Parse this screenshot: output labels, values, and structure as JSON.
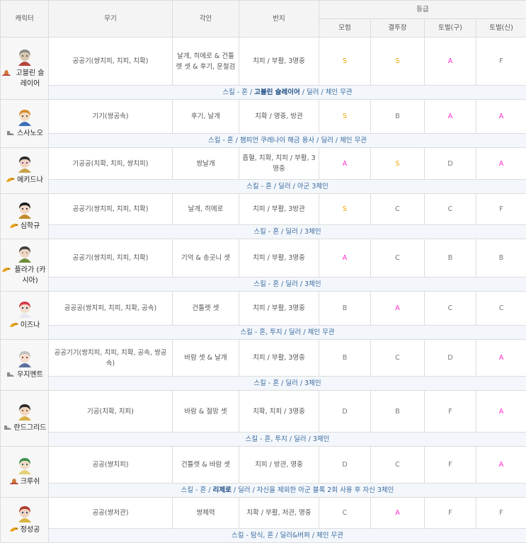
{
  "headers": {
    "character": "캐릭터",
    "weapon": "무기",
    "engraving": "각인",
    "ring": "반지",
    "grade": "등급",
    "grade_cols": [
      "모험",
      "결투장",
      "토벌(구)",
      "토벌(신)"
    ]
  },
  "rows": [
    {
      "name": "고블린 슬레이어",
      "icon": "hat-icon",
      "weapon": "공공기(쌍치피, 치피, 치확)",
      "engraving": "날개, 히에로 & 건틀렛 셋 & 후기, 운철검",
      "ring": "치피 / 부활, 3명중",
      "grades": [
        "S",
        "S",
        "A",
        "F"
      ],
      "summary_pre": "스킬 - 혼 / ",
      "summary_bold": "고블린 슬레이어",
      "summary_post": " / 딜러 / 체인 무관"
    },
    {
      "name": "스사노오",
      "icon": "shoe-icon",
      "weapon": "기기(쌍공속)",
      "engraving": "후기, 날개",
      "ring": "치확 / 명중, 방관",
      "grades": [
        "S",
        "B",
        "A",
        "A"
      ],
      "summary_pre": "스킬 - 혼 / 챔피언 쿠레나이 해금 용사 / 딜러 / 체인 무관",
      "summary_bold": "",
      "summary_post": ""
    },
    {
      "name": "에키드나",
      "icon": "horn-icon",
      "weapon": "기공공(치확, 치피, 쌍치피)",
      "engraving": "쌍날개",
      "ring": "흡혈, 치확, 치피 / 부활, 3명중",
      "grades": [
        "A",
        "S",
        "D",
        "A"
      ],
      "summary_pre": "스킬 - 혼 / 딜러 / 아군 3체인",
      "summary_bold": "",
      "summary_post": ""
    },
    {
      "name": "심학규",
      "icon": "horn-icon",
      "weapon": "공공기(쌍치피, 치피, 치확)",
      "engraving": "날개, 히에로",
      "ring": "치피 / 부활, 3방관",
      "grades": [
        "S",
        "C",
        "C",
        "F"
      ],
      "summary_pre": "스킬 - 혼 / 딜러 / 3체인",
      "summary_bold": "",
      "summary_post": ""
    },
    {
      "name": "플라가 (카시아)",
      "icon": "horn-icon",
      "weapon": "공공기(쌍치피, 치피, 치확)",
      "engraving": "기억 & 송곳니 셋",
      "ring": "치피 / 부활, 3명중",
      "grades": [
        "A",
        "C",
        "B",
        "B"
      ],
      "summary_pre": "스킬 - 혼 / 딜러 / 3체인",
      "summary_bold": "",
      "summary_post": ""
    },
    {
      "name": "이즈나",
      "icon": "horn-icon",
      "weapon": "공공공(쌍치피, 치피, 치확, 공속)",
      "engraving": "건틀렛 셋",
      "ring": "치피 / 부활, 3명중",
      "grades": [
        "B",
        "A",
        "C",
        "C"
      ],
      "summary_pre": "스킬 - 혼, 투지 / 딜러 / 체인 무관",
      "summary_bold": "",
      "summary_post": ""
    },
    {
      "name": "우지멘트",
      "icon": "shoe-icon",
      "weapon": "공공기기(쌍치피, 치피, 치확, 공속, 쌍공속)",
      "engraving": "바람 셋 & 날개",
      "ring": "치피 / 부활, 3명중",
      "grades": [
        "B",
        "C",
        "D",
        "A"
      ],
      "summary_pre": "스킬 - 혼 / 딜러 / 3체인",
      "summary_bold": "",
      "summary_post": ""
    },
    {
      "name": "란드그리드",
      "icon": "shoe-icon",
      "weapon": "기공(치확, 치피)",
      "engraving": "바람 & 절망 셋",
      "ring": "치확, 치피 / 3명중",
      "grades": [
        "D",
        "B",
        "F",
        "A"
      ],
      "summary_pre": "스킬 - 혼, 투지 / 딜러 / 3체인",
      "summary_bold": "",
      "summary_post": ""
    },
    {
      "name": "크루쉬",
      "icon": "hat-icon",
      "weapon": "공공(쌍치피)",
      "engraving": "건틀렛 & 바람 셋",
      "ring": "치피 / 방관, 명중",
      "grades": [
        "D",
        "C",
        "F",
        "A"
      ],
      "summary_pre": "스킬 - 혼 / ",
      "summary_bold": "리제로",
      "summary_post": " / 딜러 / 자신을 제외한 아군 블록 2회 사용 후 자신 3체인"
    },
    {
      "name": "정성공",
      "icon": "horn-icon",
      "weapon": "공공(쌍저관)",
      "engraving": "쌍체력",
      "ring": "치확 / 부활, 저관, 명중",
      "grades": [
        "C",
        "A",
        "F",
        "F"
      ],
      "summary_pre": "스킬 - 탐식, 혼 / 딜러&버퍼 / 체인 무관",
      "summary_bold": "",
      "summary_post": ""
    }
  ]
}
